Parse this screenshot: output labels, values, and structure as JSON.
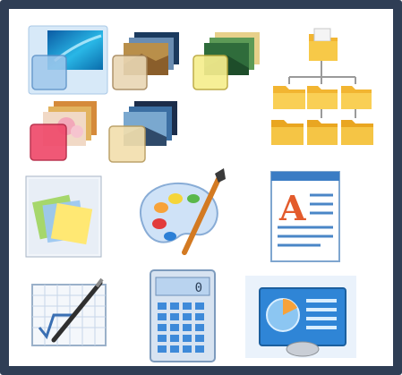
{
  "icons": [
    {
      "name": "theme-aero",
      "label": "",
      "colors": {
        "accent": "#1aa3d9"
      }
    },
    {
      "name": "theme-landscapes",
      "label": "",
      "colors": {
        "accent": "#d9b25a"
      }
    },
    {
      "name": "theme-nature",
      "label": "",
      "colors": {
        "accent": "#f1e26a"
      }
    },
    {
      "name": "folder-tree",
      "label": "",
      "colors": {
        "accent": "#f2b531"
      }
    },
    {
      "name": "theme-flowers",
      "label": "",
      "colors": {
        "accent": "#e5536d"
      }
    },
    {
      "name": "theme-scenes",
      "label": "",
      "colors": {
        "accent": "#e8c98a"
      }
    },
    {
      "name": "sticky-notes",
      "label": "",
      "colors": {
        "accent": "#ffe873"
      }
    },
    {
      "name": "paint",
      "label": "",
      "colors": {
        "accent": "#cfe2f7"
      }
    },
    {
      "name": "wordpad",
      "label": "",
      "colors": {
        "accent": "#e35b2c"
      }
    },
    {
      "name": "math-input-panel",
      "label": "",
      "colors": {
        "accent": "#3a6fb3"
      }
    },
    {
      "name": "calculator",
      "label": "",
      "colors": {
        "accent": "#3e8ad9"
      }
    },
    {
      "name": "personalization",
      "label": "",
      "colors": {
        "accent": "#2f85d6"
      }
    }
  ],
  "calculator_display": "0"
}
